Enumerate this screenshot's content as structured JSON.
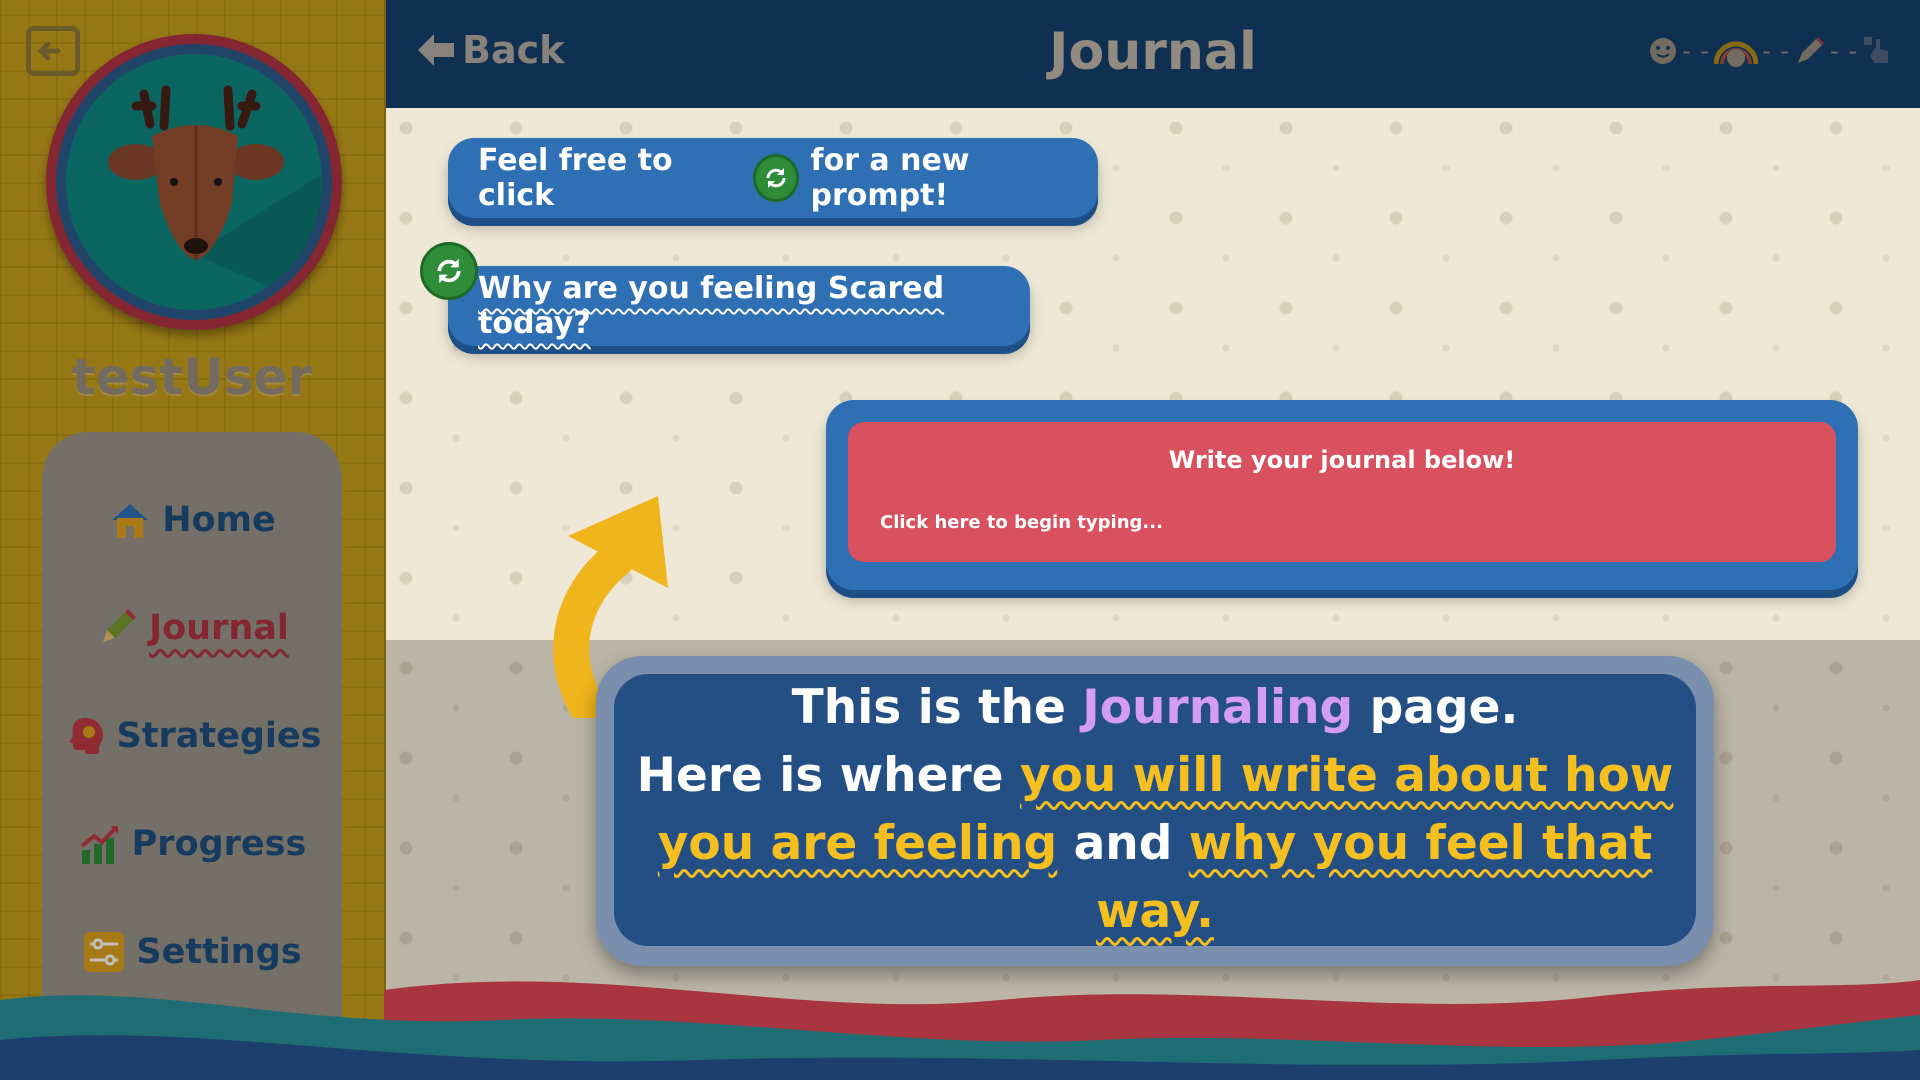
{
  "sidebar": {
    "username": "testUser",
    "nav": [
      {
        "label": "Home",
        "icon": "home-icon",
        "active": false
      },
      {
        "label": "Journal",
        "icon": "pencil-icon",
        "active": true
      },
      {
        "label": "Strategies",
        "icon": "head-icon",
        "active": false
      },
      {
        "label": "Progress",
        "icon": "chart-icon",
        "active": false
      },
      {
        "label": "Settings",
        "icon": "sliders-icon",
        "active": false
      }
    ]
  },
  "header": {
    "back_label": "Back",
    "title": "Journal"
  },
  "prompt": {
    "hint_before": "Feel free to click",
    "hint_after": "for a new prompt!",
    "question": "Why are you feeling Scared today?"
  },
  "journal": {
    "heading": "Write your journal below!",
    "placeholder": "Click here to begin typing..."
  },
  "tutorial": {
    "line1_a": "This is the",
    "line1_hl": "Journaling",
    "line1_b": "page.",
    "line2_a": "Here is where",
    "line2_hl": "you will write about how",
    "line3_hl1": "you are feeling",
    "line3_mid": "and",
    "line3_hl2": "why you feel that way."
  },
  "colors": {
    "header_bg": "#143d66",
    "sidebar_bg": "#c9a21c",
    "pill_blue": "#2f6fb4",
    "journal_red": "#d9505e",
    "highlight_yellow": "#f5c01f",
    "highlight_purple": "#d59cf5"
  }
}
